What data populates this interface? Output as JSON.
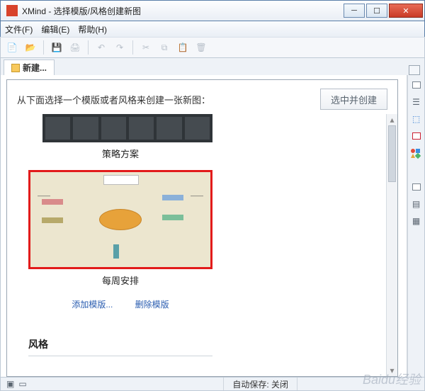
{
  "window": {
    "title": "XMind - 选择模版/风格创建新图"
  },
  "menus": {
    "file": "文件(F)",
    "edit": "编辑(E)",
    "help": "帮助(H)"
  },
  "tab": {
    "label": "新建..."
  },
  "panel": {
    "prompt": "从下面选择一个模版或者风格来创建一张新图：",
    "create_btn": "选中并创建"
  },
  "templates": {
    "strategy_caption": "策略方案",
    "weekly_caption": "每周安排"
  },
  "links": {
    "add_template": "添加模版...",
    "delete_template": "删除模版"
  },
  "section": {
    "style_title": "风格"
  },
  "status": {
    "autosave": "自动保存: 关闭"
  },
  "watermark": "Baidu经验"
}
